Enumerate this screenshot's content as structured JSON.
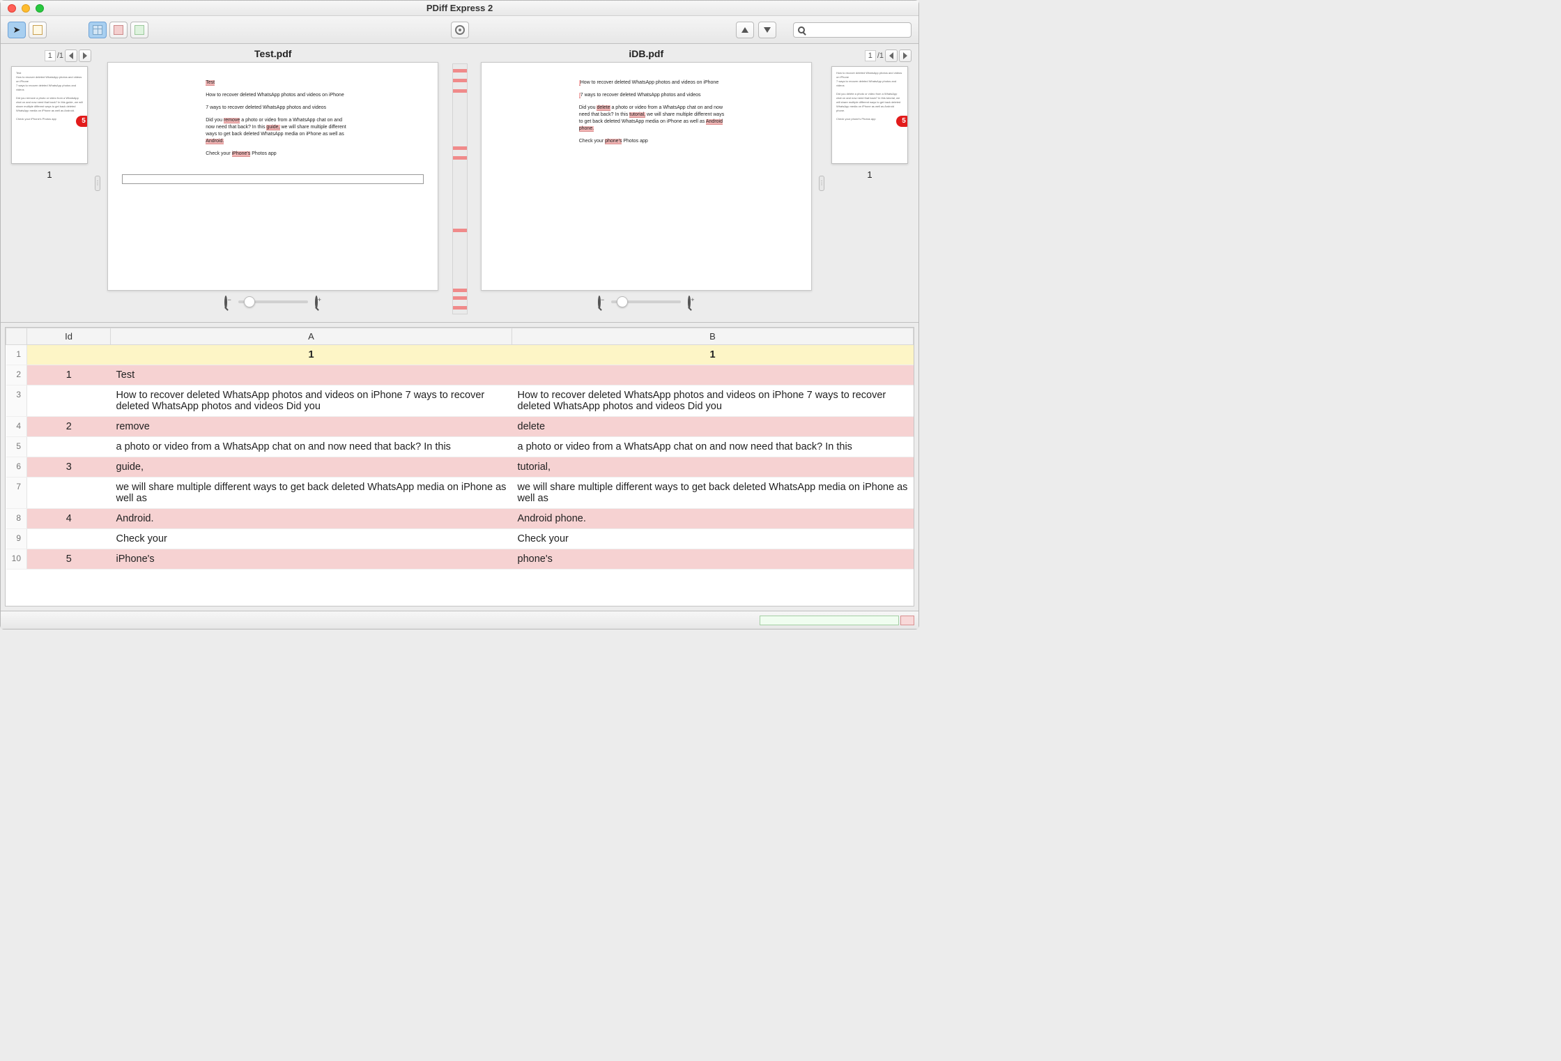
{
  "window": {
    "title": "PDiff Express 2"
  },
  "toolbar": {
    "search_placeholder": ""
  },
  "left_thumb": {
    "page_current": "1",
    "page_total": "/1",
    "label": "1",
    "badge": "5"
  },
  "right_thumb": {
    "page_current": "1",
    "page_total": "/1",
    "label": "1",
    "badge": "5"
  },
  "doc_a": {
    "title": "Test.pdf",
    "lines": [
      {
        "t": "Test",
        "hl": true
      },
      {
        "t": "How to recover deleted WhatsApp photos and videos on iPhone"
      },
      {
        "t": "7 ways to recover deleted WhatsApp photos and videos"
      },
      {
        "p": "Did you ",
        "h": "remove",
        "s": " a photo or video from a WhatsApp chat on and now need that back? In this ",
        "h2": "guide,",
        "s2": " we will share multiple different ways to get back deleted WhatsApp media on iPhone as well as ",
        "h3": "Android."
      },
      {
        "p": "Check your ",
        "h": "iPhone's",
        "s": " Photos app"
      }
    ]
  },
  "doc_b": {
    "title": "iDB.pdf",
    "lines": [
      {
        "t": "How to recover deleted WhatsApp photos and videos on iPhone"
      },
      {
        "t": "7 ways to recover deleted WhatsApp photos and videos"
      },
      {
        "p": "Did you ",
        "h": "delete",
        "s": " a photo or video from a WhatsApp chat on and now need that back? In this ",
        "h2": "tutorial,",
        "s2": " we will share multiple different ways to get back deleted WhatsApp media on iPhone as well as ",
        "h3": "Android phone."
      },
      {
        "p": "Check your ",
        "h": "phone's",
        "s": " Photos app"
      }
    ]
  },
  "overview_marks": [
    2,
    6,
    10,
    33,
    37,
    66,
    90,
    93,
    97
  ],
  "table": {
    "headers": {
      "id": "Id",
      "a": "A",
      "b": "B"
    },
    "rows": [
      {
        "n": "1",
        "id": "",
        "a": "1",
        "b": "1",
        "cls": "yellow"
      },
      {
        "n": "2",
        "id": "1",
        "a": "Test",
        "b": "",
        "cls": "pink"
      },
      {
        "n": "3",
        "id": "",
        "a": "How to recover deleted WhatsApp photos and videos on iPhone 7 ways to recover deleted WhatsApp photos and videos Did you",
        "b": "How to recover deleted WhatsApp photos and videos on iPhone 7 ways to recover deleted WhatsApp photos and videos Did you",
        "cls": ""
      },
      {
        "n": "4",
        "id": "2",
        "a": "remove",
        "b": "delete",
        "cls": "pink"
      },
      {
        "n": "5",
        "id": "",
        "a": "a photo or video from a WhatsApp chat on and now need that back? In this",
        "b": "a photo or video from a WhatsApp chat on and now need that back? In this",
        "cls": ""
      },
      {
        "n": "6",
        "id": "3",
        "a": "guide,",
        "b": "tutorial,",
        "cls": "pink"
      },
      {
        "n": "7",
        "id": "",
        "a": "we will share multiple different ways to get back deleted WhatsApp media on iPhone as well as",
        "b": "we will share multiple different ways to get back deleted WhatsApp media on iPhone as well as",
        "cls": ""
      },
      {
        "n": "8",
        "id": "4",
        "a": "Android.",
        "b": "Android phone.",
        "cls": "pink"
      },
      {
        "n": "9",
        "id": "",
        "a": "Check your",
        "b": "Check your",
        "cls": ""
      },
      {
        "n": "10",
        "id": "5",
        "a": "iPhone's",
        "b": "phone's",
        "cls": "pink"
      }
    ]
  }
}
